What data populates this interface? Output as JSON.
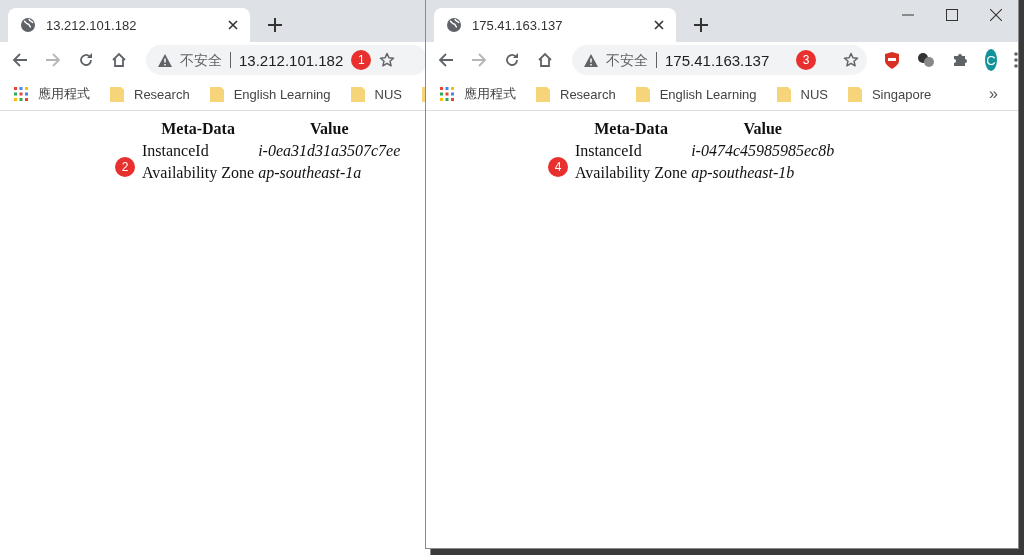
{
  "windows": [
    {
      "tab": {
        "title": "13.212.101.182",
        "selected": true
      },
      "forward_disabled": true,
      "address": {
        "security": "不安全",
        "url": "13.212.101.182",
        "marker": "1"
      },
      "bookmarks": [
        {
          "kind": "apps",
          "label": "應用程式"
        },
        {
          "kind": "folder",
          "label": "Research"
        },
        {
          "kind": "folder",
          "label": "English Learning"
        },
        {
          "kind": "folder",
          "label": "NUS"
        },
        {
          "kind": "folder"
        }
      ],
      "page": {
        "marker": "2",
        "columns": [
          "Meta-Data",
          "Value"
        ],
        "rows": [
          [
            "InstanceId",
            "i-0ea31d31a3507c7ee"
          ],
          [
            "Availability Zone",
            "ap-southeast-1a"
          ]
        ]
      }
    },
    {
      "tab": {
        "title": "175.41.163.137",
        "selected": true
      },
      "forward_disabled": true,
      "address": {
        "security": "不安全",
        "url": "175.41.163.137",
        "marker": "3"
      },
      "extensions": [
        {
          "kind": "shield"
        },
        {
          "kind": "balls"
        },
        {
          "kind": "puzzle"
        },
        {
          "kind": "avatar",
          "label": "C"
        },
        {
          "kind": "menu"
        }
      ],
      "bookmarks": [
        {
          "kind": "apps",
          "label": "應用程式"
        },
        {
          "kind": "folder",
          "label": "Research"
        },
        {
          "kind": "folder",
          "label": "English Learning"
        },
        {
          "kind": "folder",
          "label": "NUS"
        },
        {
          "kind": "folder",
          "label": "Singapore"
        },
        {
          "kind": "overflow",
          "label": "»"
        }
      ],
      "page": {
        "marker": "4",
        "columns": [
          "Meta-Data",
          "Value"
        ],
        "rows": [
          [
            "InstanceId",
            "i-0474c45985985ec8b"
          ],
          [
            "Availability Zone",
            "ap-southeast-1b"
          ]
        ]
      }
    }
  ]
}
